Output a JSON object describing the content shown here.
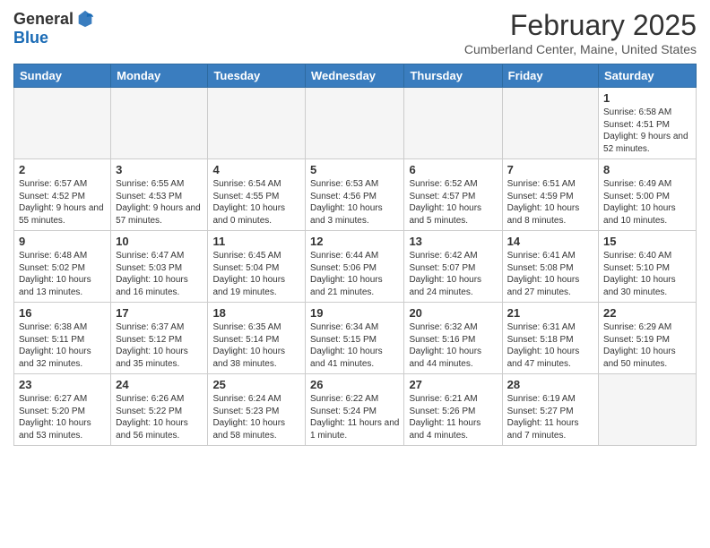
{
  "logo": {
    "general": "General",
    "blue": "Blue"
  },
  "header": {
    "month_year": "February 2025",
    "location": "Cumberland Center, Maine, United States"
  },
  "days_of_week": [
    "Sunday",
    "Monday",
    "Tuesday",
    "Wednesday",
    "Thursday",
    "Friday",
    "Saturday"
  ],
  "weeks": [
    [
      {
        "day": "",
        "info": ""
      },
      {
        "day": "",
        "info": ""
      },
      {
        "day": "",
        "info": ""
      },
      {
        "day": "",
        "info": ""
      },
      {
        "day": "",
        "info": ""
      },
      {
        "day": "",
        "info": ""
      },
      {
        "day": "1",
        "info": "Sunrise: 6:58 AM\nSunset: 4:51 PM\nDaylight: 9 hours and 52 minutes."
      }
    ],
    [
      {
        "day": "2",
        "info": "Sunrise: 6:57 AM\nSunset: 4:52 PM\nDaylight: 9 hours and 55 minutes."
      },
      {
        "day": "3",
        "info": "Sunrise: 6:55 AM\nSunset: 4:53 PM\nDaylight: 9 hours and 57 minutes."
      },
      {
        "day": "4",
        "info": "Sunrise: 6:54 AM\nSunset: 4:55 PM\nDaylight: 10 hours and 0 minutes."
      },
      {
        "day": "5",
        "info": "Sunrise: 6:53 AM\nSunset: 4:56 PM\nDaylight: 10 hours and 3 minutes."
      },
      {
        "day": "6",
        "info": "Sunrise: 6:52 AM\nSunset: 4:57 PM\nDaylight: 10 hours and 5 minutes."
      },
      {
        "day": "7",
        "info": "Sunrise: 6:51 AM\nSunset: 4:59 PM\nDaylight: 10 hours and 8 minutes."
      },
      {
        "day": "8",
        "info": "Sunrise: 6:49 AM\nSunset: 5:00 PM\nDaylight: 10 hours and 10 minutes."
      }
    ],
    [
      {
        "day": "9",
        "info": "Sunrise: 6:48 AM\nSunset: 5:02 PM\nDaylight: 10 hours and 13 minutes."
      },
      {
        "day": "10",
        "info": "Sunrise: 6:47 AM\nSunset: 5:03 PM\nDaylight: 10 hours and 16 minutes."
      },
      {
        "day": "11",
        "info": "Sunrise: 6:45 AM\nSunset: 5:04 PM\nDaylight: 10 hours and 19 minutes."
      },
      {
        "day": "12",
        "info": "Sunrise: 6:44 AM\nSunset: 5:06 PM\nDaylight: 10 hours and 21 minutes."
      },
      {
        "day": "13",
        "info": "Sunrise: 6:42 AM\nSunset: 5:07 PM\nDaylight: 10 hours and 24 minutes."
      },
      {
        "day": "14",
        "info": "Sunrise: 6:41 AM\nSunset: 5:08 PM\nDaylight: 10 hours and 27 minutes."
      },
      {
        "day": "15",
        "info": "Sunrise: 6:40 AM\nSunset: 5:10 PM\nDaylight: 10 hours and 30 minutes."
      }
    ],
    [
      {
        "day": "16",
        "info": "Sunrise: 6:38 AM\nSunset: 5:11 PM\nDaylight: 10 hours and 32 minutes."
      },
      {
        "day": "17",
        "info": "Sunrise: 6:37 AM\nSunset: 5:12 PM\nDaylight: 10 hours and 35 minutes."
      },
      {
        "day": "18",
        "info": "Sunrise: 6:35 AM\nSunset: 5:14 PM\nDaylight: 10 hours and 38 minutes."
      },
      {
        "day": "19",
        "info": "Sunrise: 6:34 AM\nSunset: 5:15 PM\nDaylight: 10 hours and 41 minutes."
      },
      {
        "day": "20",
        "info": "Sunrise: 6:32 AM\nSunset: 5:16 PM\nDaylight: 10 hours and 44 minutes."
      },
      {
        "day": "21",
        "info": "Sunrise: 6:31 AM\nSunset: 5:18 PM\nDaylight: 10 hours and 47 minutes."
      },
      {
        "day": "22",
        "info": "Sunrise: 6:29 AM\nSunset: 5:19 PM\nDaylight: 10 hours and 50 minutes."
      }
    ],
    [
      {
        "day": "23",
        "info": "Sunrise: 6:27 AM\nSunset: 5:20 PM\nDaylight: 10 hours and 53 minutes."
      },
      {
        "day": "24",
        "info": "Sunrise: 6:26 AM\nSunset: 5:22 PM\nDaylight: 10 hours and 56 minutes."
      },
      {
        "day": "25",
        "info": "Sunrise: 6:24 AM\nSunset: 5:23 PM\nDaylight: 10 hours and 58 minutes."
      },
      {
        "day": "26",
        "info": "Sunrise: 6:22 AM\nSunset: 5:24 PM\nDaylight: 11 hours and 1 minute."
      },
      {
        "day": "27",
        "info": "Sunrise: 6:21 AM\nSunset: 5:26 PM\nDaylight: 11 hours and 4 minutes."
      },
      {
        "day": "28",
        "info": "Sunrise: 6:19 AM\nSunset: 5:27 PM\nDaylight: 11 hours and 7 minutes."
      },
      {
        "day": "",
        "info": ""
      }
    ]
  ]
}
